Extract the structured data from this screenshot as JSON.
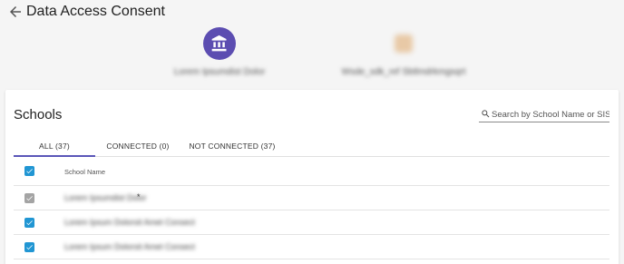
{
  "header": {
    "title": "Data Access Consent"
  },
  "parties": {
    "institution_name": "Lorem Ipsumdist Dolor",
    "application_name": "Wsde_sdk_ref Sbtlmdrkmgsqrt"
  },
  "schools": {
    "title": "Schools",
    "search_placeholder": "Search by School Name or SIS ID",
    "tabs": [
      {
        "label": "ALL (37)",
        "active": true
      },
      {
        "label": "CONNECTED (0)",
        "active": false
      },
      {
        "label": "NOT CONNECTED (37)",
        "active": false
      }
    ],
    "column_header": "School Name",
    "rows": [
      {
        "name": "Lorem Ipsumdist Dolor",
        "required_mark": "*",
        "checkbox": "disabled-checked"
      },
      {
        "name": "Lorem Ipsum Dolorsit Amet Consect",
        "required_mark": "",
        "checkbox": "checked"
      },
      {
        "name": "Lorem Ipsum Dolorsit Amet Consect",
        "required_mark": "",
        "checkbox": "checked"
      }
    ]
  },
  "colors": {
    "accent": "#5a56b8",
    "avatar": "#5c4db1",
    "checkbox": "#2196d3",
    "checkbox_disabled": "#a4a4a4"
  }
}
